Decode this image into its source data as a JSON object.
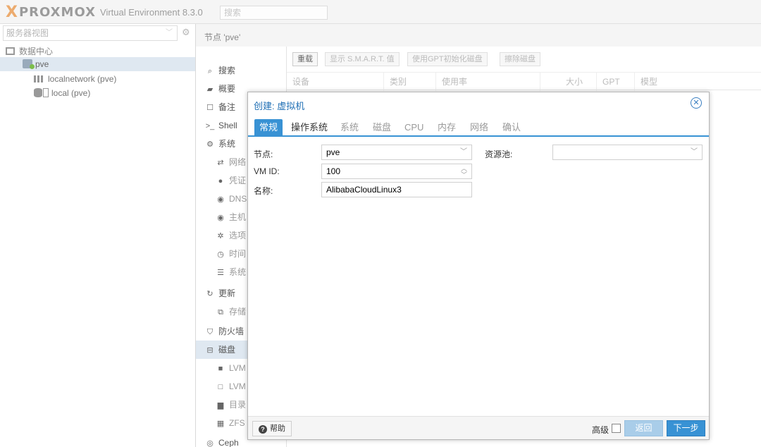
{
  "app": {
    "logo_x": "X",
    "brand": "PROXMOX",
    "version": "Virtual Environment 8.3.0",
    "search_placeholder": "搜索"
  },
  "left": {
    "view_label": "服务器视图",
    "tree": {
      "datacenter": "数据中心",
      "node": "pve",
      "network": "localnetwork (pve)",
      "storage": "local (pve)"
    }
  },
  "node_title": "节点 'pve'",
  "nav": [
    {
      "label": "搜索",
      "icon": "search-icon"
    },
    {
      "label": "概要",
      "icon": "book-icon"
    },
    {
      "label": "备注",
      "icon": "note-icon"
    },
    {
      "label": "Shell",
      "icon": "terminal-icon"
    },
    {
      "label": "系统",
      "icon": "cogs-icon"
    },
    {
      "label": "网络",
      "icon": "exchange-icon"
    },
    {
      "label": "凭证",
      "icon": "certificate-icon"
    },
    {
      "label": "DNS",
      "icon": "globe-icon"
    },
    {
      "label": "主机",
      "icon": "globe-icon"
    },
    {
      "label": "选项",
      "icon": "gear-icon"
    },
    {
      "label": "时间",
      "icon": "clock-icon"
    },
    {
      "label": "系统",
      "icon": "list-icon"
    },
    {
      "label": "更新",
      "icon": "refresh-icon"
    },
    {
      "label": "存储",
      "icon": "files-icon"
    },
    {
      "label": "防火墙",
      "icon": "shield-icon"
    },
    {
      "label": "磁盘",
      "icon": "hdd-icon"
    },
    {
      "label": "LVM",
      "icon": "square-icon"
    },
    {
      "label": "LVM",
      "icon": "square-outline-icon"
    },
    {
      "label": "目录",
      "icon": "folder-icon"
    },
    {
      "label": "ZFS",
      "icon": "grid-icon"
    },
    {
      "label": "Ceph",
      "icon": "ceph-icon"
    }
  ],
  "disk_toolbar": {
    "reload": "重载",
    "smart": "显示 S.M.A.R.T. 值",
    "init_gpt": "使用GPT初始化磁盘",
    "wipe": "擦除磁盘"
  },
  "grid_columns": [
    "设备",
    "类别",
    "使用率",
    "大小",
    "GPT",
    "模型"
  ],
  "dialog": {
    "title": "创建: 虚拟机",
    "tabs": [
      "常规",
      "操作系统",
      "系统",
      "磁盘",
      "CPU",
      "内存",
      "网络",
      "确认"
    ],
    "fields": {
      "node_label": "节点:",
      "node_value": "pve",
      "vmid_label": "VM ID:",
      "vmid_value": "100",
      "name_label": "名称:",
      "name_value": "AlibabaCloudLinux3",
      "pool_label": "资源池:",
      "pool_value": ""
    },
    "footer": {
      "help": "帮助",
      "advanced": "高级",
      "back": "返回",
      "next": "下一步"
    }
  },
  "colors": {
    "accent": "#3892d4",
    "selection": "#dfe8f1",
    "brand_orange": "#e57000"
  }
}
